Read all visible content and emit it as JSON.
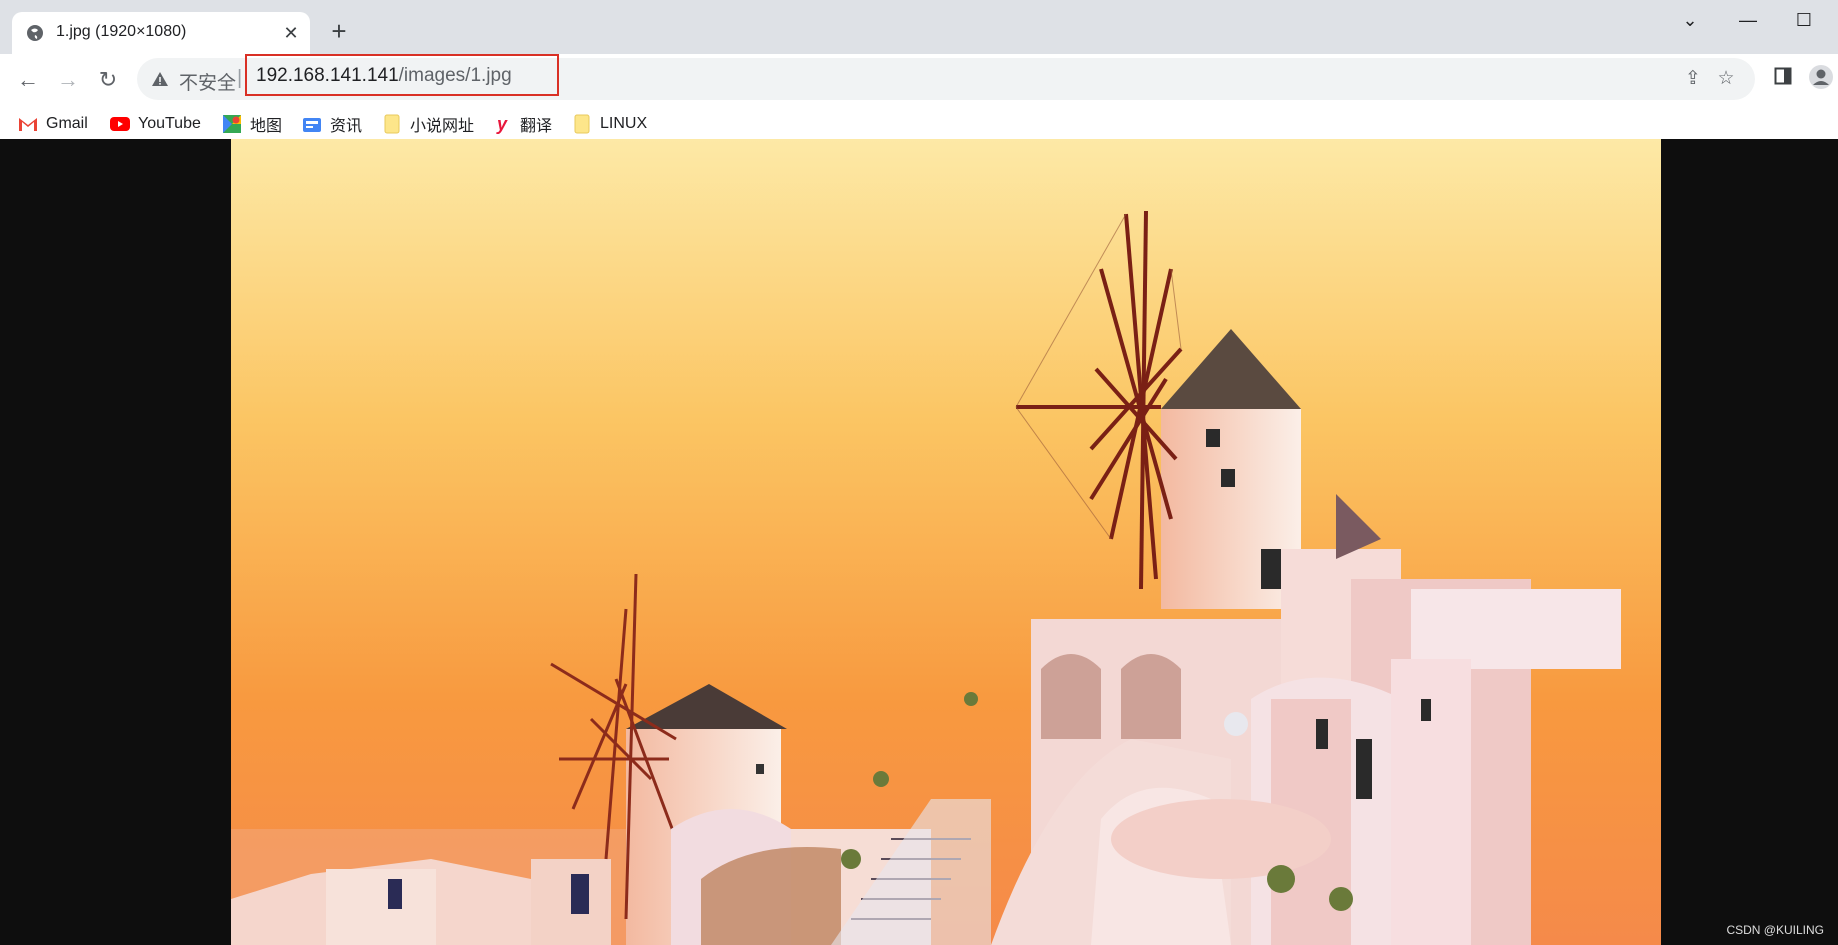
{
  "tab": {
    "title": "1.jpg (1920×1080)",
    "close": "✕"
  },
  "new_tab": "+",
  "window": {
    "dropdown": "⌄",
    "minimize": "—",
    "maximize": "☐"
  },
  "nav": {
    "back": "←",
    "forward": "→",
    "reload": "↻"
  },
  "address": {
    "security_label": "不安全",
    "separator": "|",
    "host": "192.168.141.141",
    "path": "/images/1.jpg"
  },
  "bookmarks": [
    {
      "label": "Gmail",
      "icon": "gmail-icon"
    },
    {
      "label": "YouTube",
      "icon": "youtube-icon"
    },
    {
      "label": "地图",
      "icon": "maps-icon"
    },
    {
      "label": "资讯",
      "icon": "news-icon"
    },
    {
      "label": "小说网址",
      "icon": "folder-icon"
    },
    {
      "label": "翻译",
      "icon": "translate-icon"
    },
    {
      "label": "LINUX",
      "icon": "folder-icon"
    }
  ],
  "watermark": "CSDN @KUILING",
  "colors": {
    "highlight_box": "#d93025",
    "viewer_bg": "#0e0e0e"
  }
}
